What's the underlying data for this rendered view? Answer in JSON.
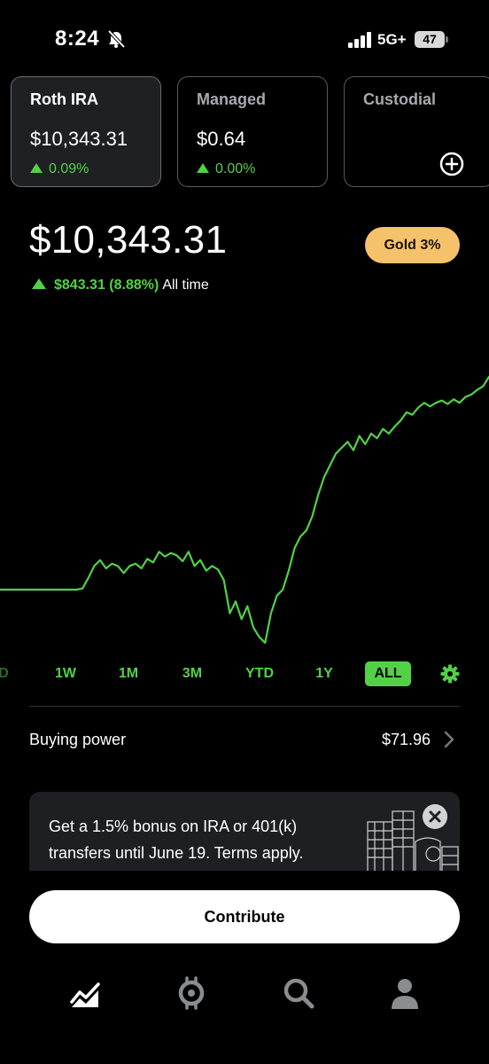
{
  "status_bar": {
    "time": "8:24",
    "network": "5G+",
    "battery": "47"
  },
  "accounts": [
    {
      "name": "Roth IRA",
      "amount": "$10,343.31",
      "change": "0.09%",
      "active": true
    },
    {
      "name": "Managed",
      "amount": "$0.64",
      "change": "0.00%",
      "active": false
    },
    {
      "name": "Custodial",
      "amount": "",
      "change": "",
      "active": false,
      "action_icon": "plus-circle-icon"
    }
  ],
  "portfolio": {
    "balance": "$10,343.31",
    "gold_badge": "Gold 3%",
    "gain": "$843.31 (8.88%)",
    "gain_label": "All time"
  },
  "chart_data": {
    "type": "line",
    "color": "#52d145",
    "values": [
      4400,
      4400,
      4400,
      4400,
      4400,
      4400,
      4400,
      4400,
      4400,
      4400,
      4400,
      4400,
      4400,
      4400,
      4410,
      4500,
      4600,
      4650,
      4580,
      4620,
      4600,
      4540,
      4600,
      4620,
      4580,
      4660,
      4630,
      4720,
      4680,
      4710,
      4690,
      4640,
      4720,
      4600,
      4650,
      4560,
      4600,
      4570,
      4480,
      4200,
      4300,
      4150,
      4260,
      4080,
      4000,
      3950,
      4200,
      4350,
      4400,
      4560,
      4750,
      4850,
      4900,
      5020,
      5200,
      5350,
      5450,
      5550,
      5600,
      5650,
      5580,
      5700,
      5630,
      5720,
      5680,
      5760,
      5720,
      5780,
      5830,
      5900,
      5880,
      5940,
      5980,
      5950,
      5980,
      6000,
      5970,
      6010,
      5980,
      6030,
      6050,
      6090,
      6120,
      6200
    ]
  },
  "ranges": {
    "partial": "D",
    "items": [
      "1W",
      "1M",
      "3M",
      "YTD",
      "1Y",
      "ALL"
    ],
    "active": "ALL"
  },
  "buying_power": {
    "label": "Buying power",
    "value": "$71.96"
  },
  "promo": {
    "text": "Get a 1.5% bonus on IRA or 401(k) transfers until June 19. Terms apply."
  },
  "contribute_label": "Contribute",
  "nav": [
    "chart-icon",
    "crypto-icon",
    "search-icon",
    "profile-icon"
  ]
}
